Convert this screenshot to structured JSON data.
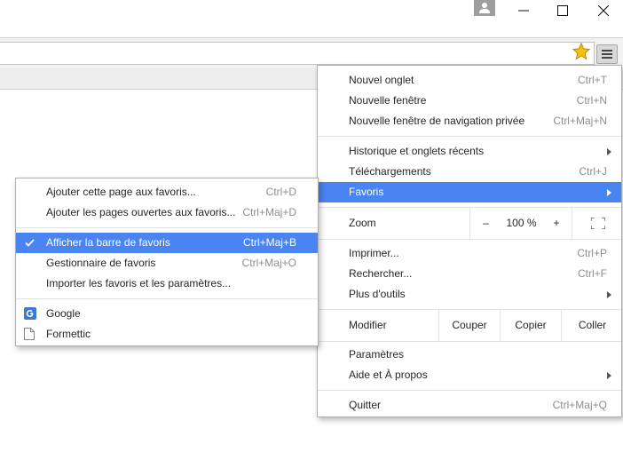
{
  "main_menu": {
    "items": [
      {
        "label": "Nouvel onglet",
        "shortcut": "Ctrl+T"
      },
      {
        "label": "Nouvelle fenêtre",
        "shortcut": "Ctrl+N"
      },
      {
        "label": "Nouvelle fenêtre de navigation privée",
        "shortcut": "Ctrl+Maj+N"
      },
      {
        "label": "Historique et onglets récents",
        "shortcut": ""
      },
      {
        "label": "Téléchargements",
        "shortcut": "Ctrl+J"
      },
      {
        "label": "Favoris",
        "shortcut": ""
      },
      {
        "label": "Imprimer...",
        "shortcut": "Ctrl+P"
      },
      {
        "label": "Rechercher...",
        "shortcut": "Ctrl+F"
      },
      {
        "label": "Plus d'outils",
        "shortcut": ""
      },
      {
        "label": "Paramètres",
        "shortcut": ""
      },
      {
        "label": "Aide et À propos",
        "shortcut": ""
      },
      {
        "label": "Quitter",
        "shortcut": "Ctrl+Maj+Q"
      }
    ],
    "zoom": {
      "label": "Zoom",
      "minus": "–",
      "value": "100 %",
      "plus": "+"
    },
    "edit": {
      "label": "Modifier",
      "cut": "Couper",
      "copy": "Copier",
      "paste": "Coller"
    }
  },
  "favorites_submenu": {
    "items": [
      {
        "label": "Ajouter cette page aux favoris...",
        "shortcut": "Ctrl+D"
      },
      {
        "label": "Ajouter les pages ouvertes aux favoris...",
        "shortcut": "Ctrl+Maj+D"
      },
      {
        "label": "Afficher la barre de favoris",
        "shortcut": "Ctrl+Maj+B",
        "checked": true
      },
      {
        "label": "Gestionnaire de favoris",
        "shortcut": "Ctrl+Maj+O"
      },
      {
        "label": "Importer les favoris et les paramètres...",
        "shortcut": ""
      }
    ],
    "bookmarks": [
      {
        "label": "Google",
        "icon": "google-icon"
      },
      {
        "label": "Formettic",
        "icon": "page-icon"
      }
    ]
  },
  "colors": {
    "highlight": "#4a83f2",
    "star": "#f4c20d",
    "google_badge": "#3d78d8"
  }
}
